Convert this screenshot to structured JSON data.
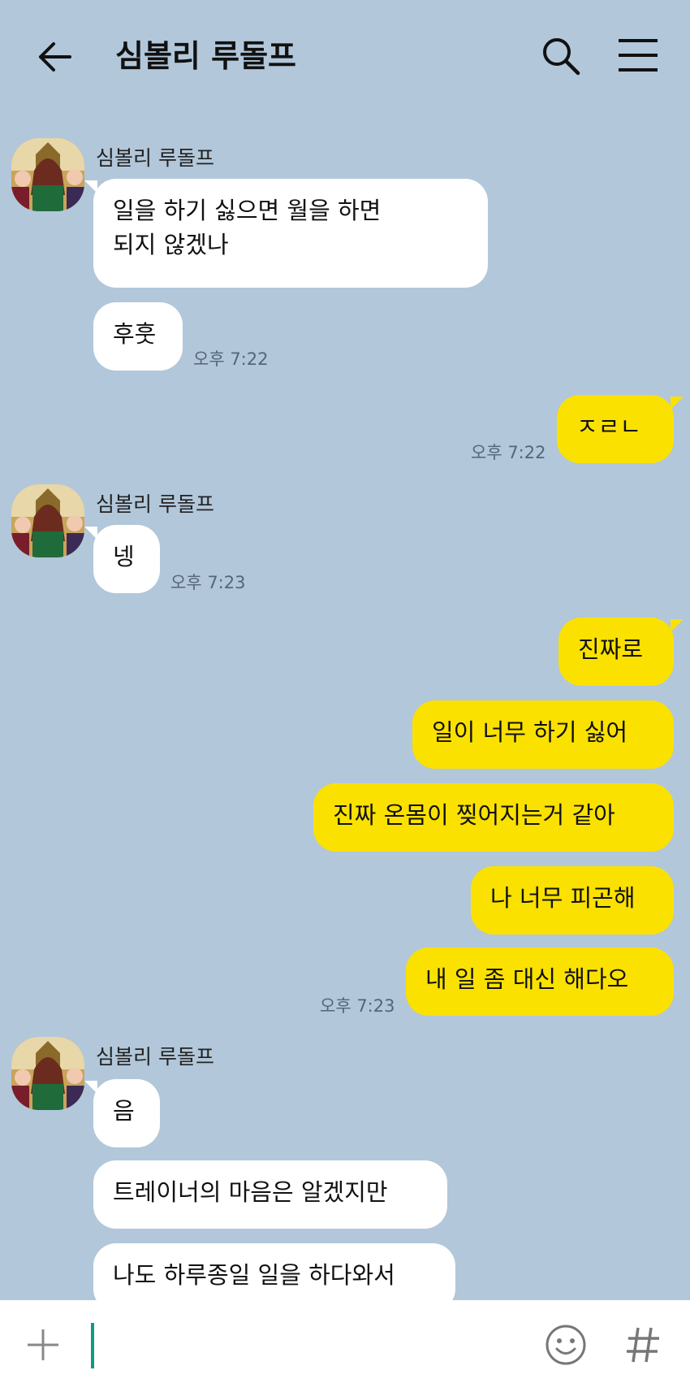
{
  "header": {
    "title": "심볼리 루돌프"
  },
  "messages": [
    {
      "sender": "심볼리 루돌프",
      "text1": "일을 하기 싫으면 월을 하면",
      "text2": "되지 않겠나"
    },
    {
      "text": "후훗",
      "time": "오후 7:22"
    },
    {
      "text": "ㅈㄹㄴ",
      "time": "오후 7:22"
    },
    {
      "sender": "심볼리 루돌프",
      "text": "넹",
      "time": "오후 7:23"
    },
    {
      "text": "진짜로"
    },
    {
      "text": "일이 너무 하기 싫어"
    },
    {
      "text": "진짜 온몸이 찢어지는거 같아"
    },
    {
      "text": "나 너무 피곤해"
    },
    {
      "text": "내 일 좀 대신 해다오",
      "time": "오후 7:23"
    },
    {
      "sender": "심볼리 루돌프",
      "text": "음"
    },
    {
      "text": "트레이너의 마음은 알겠지만"
    },
    {
      "text": "나도 하루종일 일을 하다와서"
    }
  ],
  "colors": {
    "background": "#b2c7da",
    "incoming": "#ffffff",
    "outgoing": "#fae100",
    "caret": "#119988"
  },
  "icons": {
    "back": "arrow-left-icon",
    "search": "search-icon",
    "menu": "hamburger-menu-icon",
    "attach": "plus-icon",
    "emoji": "emoji-icon",
    "hashtag": "hashtag-icon"
  }
}
